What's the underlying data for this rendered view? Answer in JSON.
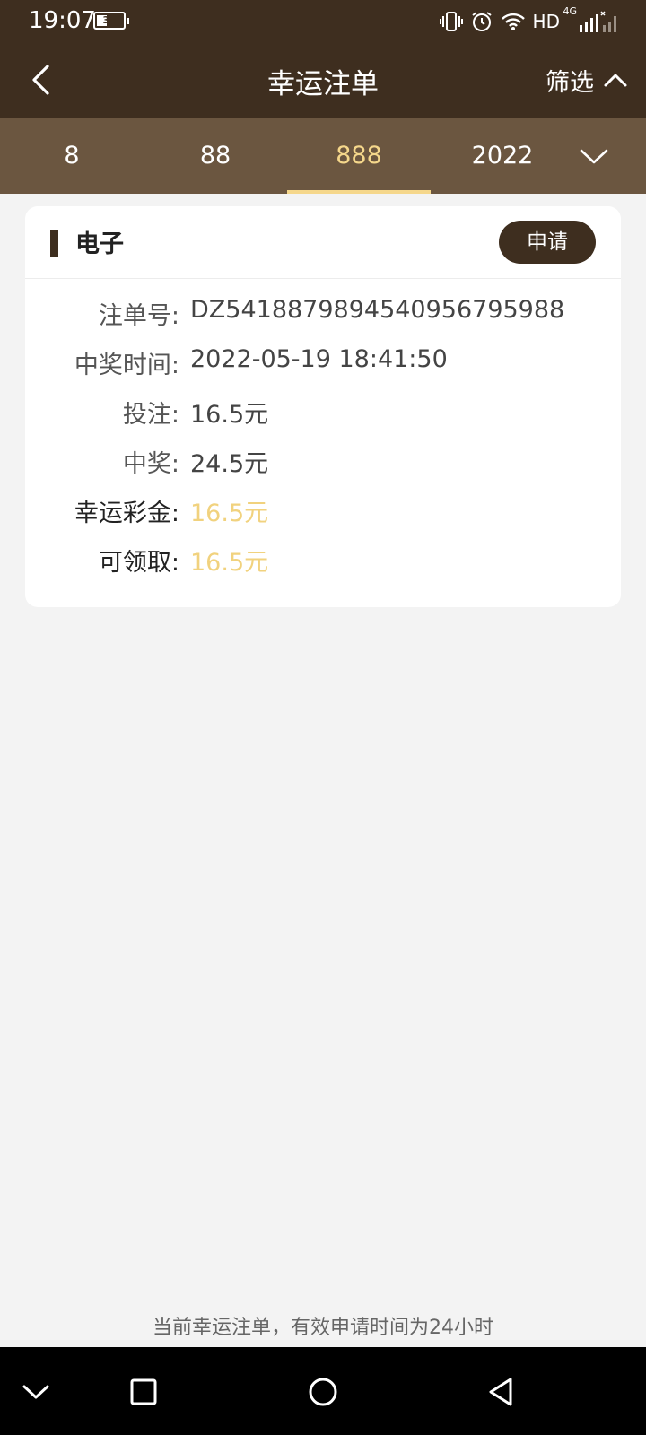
{
  "status_bar": {
    "time": "19:07",
    "battery": "35",
    "network": "HD",
    "network_gen": "4G"
  },
  "navbar": {
    "title": "幸运注单",
    "filter_label": "筛选"
  },
  "tabs": [
    {
      "label": "8",
      "active": false
    },
    {
      "label": "88",
      "active": false
    },
    {
      "label": "888",
      "active": true
    },
    {
      "label": "2022",
      "active": false
    }
  ],
  "card": {
    "title": "电子",
    "apply_label": "申请",
    "rows": [
      {
        "label": "注单号:",
        "value": "DZ54188798945409567959​88"
      },
      {
        "label": "中奖时间:",
        "value": "2022-05-19 18:41:50"
      },
      {
        "label": "投注:",
        "value": "16.5元"
      },
      {
        "label": "中奖:",
        "value": "24.5元"
      },
      {
        "label": "幸运彩金:",
        "value": "16.5元"
      },
      {
        "label": "可领取:",
        "value": "16.5元"
      }
    ]
  },
  "footer_note": "当前幸运注单，有效申请时间为24小时",
  "colors": {
    "header_bg": "#3e2e1f",
    "tab_bar_bg": "#6b5640",
    "accent_gold": "#f5d78b",
    "value_gold": "#f1d27e",
    "page_bg": "#f3f3f3"
  }
}
